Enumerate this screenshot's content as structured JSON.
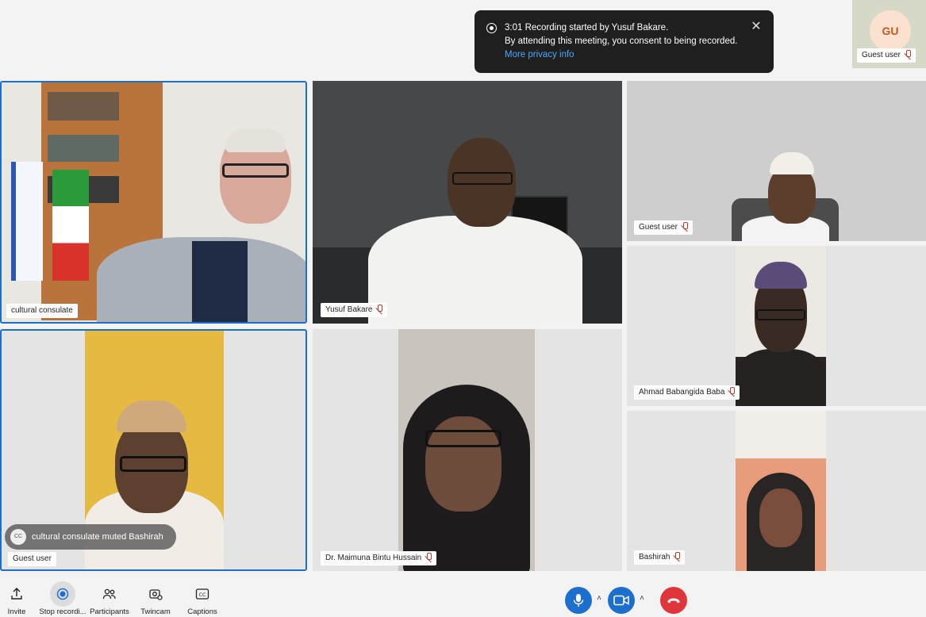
{
  "notification": {
    "line1": "3:01 Recording started by Yusuf Bakare.",
    "line2": "By attending this meeting, you consent to being recorded.",
    "link": "More privacy info"
  },
  "self_view": {
    "initials": "GU",
    "name": "Guest user"
  },
  "tiles": [
    {
      "name": "cultural consulate"
    },
    {
      "name": "Yusuf Bakare"
    },
    {
      "name": "Guest user"
    },
    {
      "name": "Ahmad Babangida Baba"
    },
    {
      "name": "Guest user"
    },
    {
      "name": "Dr. Maimuna Bintu Hussain"
    },
    {
      "name": "Bashirah"
    }
  ],
  "caption_banner": {
    "icon_text": "CC",
    "text": "cultural consulate muted Bashirah"
  },
  "toolbar": {
    "invite": "Invite",
    "stop_recording": "Stop recordi...",
    "participants": "Participants",
    "twincam": "Twincam",
    "captions": "Captions"
  },
  "colors": {
    "accent": "#1d6fce",
    "end_call": "#e0353b",
    "toast_bg": "#1f1f1f"
  }
}
